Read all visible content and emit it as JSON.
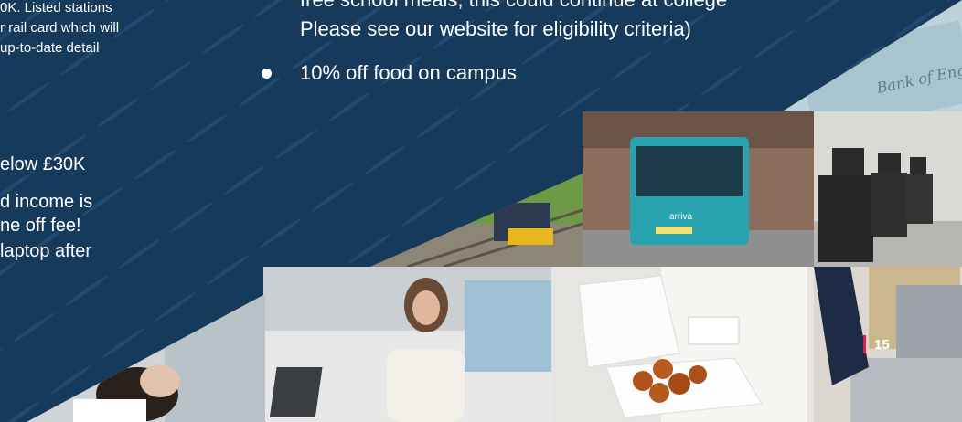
{
  "left_column": {
    "small_lines": [
      "0K. Listed stations",
      "r rail card which will",
      "up-to-date detail"
    ],
    "big_lines": [
      "elow £30K",
      "d income is",
      "ne off fee!",
      "laptop after"
    ]
  },
  "right_column": {
    "top_lines": [
      "free school meals, this could continue at college",
      "Please see our website for eligibility criteria)"
    ],
    "bullet_text": "10% off food on campus"
  },
  "photos": {
    "banknote": "Bank of England",
    "bus": "arriva"
  },
  "page_number": "15",
  "colors": {
    "background": "#163a5c",
    "accent": "#d6204e",
    "text": "#ffffff"
  }
}
